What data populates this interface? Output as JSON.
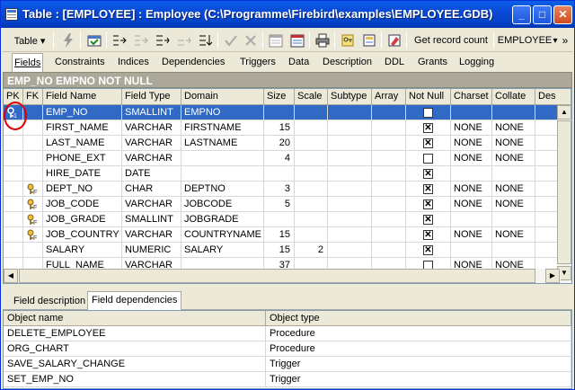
{
  "window": {
    "title": "Table : [EMPLOYEE] : Employee (C:\\Programme\\Firebird\\examples\\EMPLOYEE.GDB)",
    "minimize": "_",
    "maximize": "□",
    "close": "✕"
  },
  "toolbar": {
    "table_dropdown": "Table ▾",
    "get_record_count": "Get record count",
    "employee_dropdown": "EMPLOYEE",
    "employee_arrow": "▾",
    "icons": [
      "lightning-icon",
      "open-table-icon",
      "insert-field-icon",
      "delete-field-icon",
      "move-right-icon",
      "move-disabled-icon",
      "move-down-icon",
      "checkmark-icon",
      "cancel-icon",
      "calendar-icon",
      "calendar-red-icon",
      "print-icon",
      "key-icon",
      "export-icon",
      "eraser-icon"
    ],
    "more": "»"
  },
  "tabs": [
    {
      "label": "Fields",
      "active": true
    },
    {
      "label": "Constraints"
    },
    {
      "label": "Indices"
    },
    {
      "label": "Dependencies"
    },
    {
      "label": "Triggers"
    },
    {
      "label": "Data"
    },
    {
      "label": "Description"
    },
    {
      "label": "DDL"
    },
    {
      "label": "Grants"
    },
    {
      "label": "Logging"
    }
  ],
  "field_header": "EMP_NO EMPNO NOT NULL",
  "grid": {
    "columns": [
      "PK",
      "FK",
      "Field Name",
      "Field Type",
      "Domain",
      "Size",
      "Scale",
      "Subtype",
      "Array",
      "Not Null",
      "Charset",
      "Collate",
      "Des"
    ],
    "rows": [
      {
        "pk": true,
        "fk": false,
        "name": "EMP_NO",
        "type": "SMALLINT",
        "domain": "EMPNO",
        "size": "",
        "scale": "",
        "subtype": "",
        "array": "",
        "not_null": true,
        "charset": "",
        "collate": "",
        "selected": true
      },
      {
        "pk": false,
        "fk": false,
        "name": "FIRST_NAME",
        "type": "VARCHAR",
        "domain": "FIRSTNAME",
        "size": "15",
        "scale": "",
        "subtype": "",
        "array": "",
        "not_null": true,
        "charset": "NONE",
        "collate": "NONE"
      },
      {
        "pk": false,
        "fk": false,
        "name": "LAST_NAME",
        "type": "VARCHAR",
        "domain": "LASTNAME",
        "size": "20",
        "scale": "",
        "subtype": "",
        "array": "",
        "not_null": true,
        "charset": "NONE",
        "collate": "NONE"
      },
      {
        "pk": false,
        "fk": false,
        "name": "PHONE_EXT",
        "type": "VARCHAR",
        "domain": "",
        "size": "4",
        "scale": "",
        "subtype": "",
        "array": "",
        "not_null": false,
        "charset": "NONE",
        "collate": "NONE"
      },
      {
        "pk": false,
        "fk": false,
        "name": "HIRE_DATE",
        "type": "DATE",
        "domain": "",
        "size": "",
        "scale": "",
        "subtype": "",
        "array": "",
        "not_null": true,
        "charset": "",
        "collate": ""
      },
      {
        "pk": false,
        "fk": true,
        "name": "DEPT_NO",
        "type": "CHAR",
        "domain": "DEPTNO",
        "size": "3",
        "scale": "",
        "subtype": "",
        "array": "",
        "not_null": true,
        "charset": "NONE",
        "collate": "NONE"
      },
      {
        "pk": false,
        "fk": true,
        "name": "JOB_CODE",
        "type": "VARCHAR",
        "domain": "JOBCODE",
        "size": "5",
        "scale": "",
        "subtype": "",
        "array": "",
        "not_null": true,
        "charset": "NONE",
        "collate": "NONE"
      },
      {
        "pk": false,
        "fk": true,
        "name": "JOB_GRADE",
        "type": "SMALLINT",
        "domain": "JOBGRADE",
        "size": "",
        "scale": "",
        "subtype": "",
        "array": "",
        "not_null": true,
        "charset": "",
        "collate": ""
      },
      {
        "pk": false,
        "fk": true,
        "name": "JOB_COUNTRY",
        "type": "VARCHAR",
        "domain": "COUNTRYNAME",
        "size": "15",
        "scale": "",
        "subtype": "",
        "array": "",
        "not_null": true,
        "charset": "NONE",
        "collate": "NONE"
      },
      {
        "pk": false,
        "fk": false,
        "name": "SALARY",
        "type": "NUMERIC",
        "domain": "SALARY",
        "size": "15",
        "scale": "2",
        "subtype": "",
        "array": "",
        "not_null": true,
        "charset": "",
        "collate": ""
      },
      {
        "pk": false,
        "fk": false,
        "name": "FULL_NAME",
        "type": "VARCHAR",
        "domain": "",
        "size": "37",
        "scale": "",
        "subtype": "",
        "array": "",
        "not_null": false,
        "charset": "NONE",
        "collate": "NONE"
      }
    ]
  },
  "lower_tabs": [
    {
      "label": "Field description"
    },
    {
      "label": "Field dependencies",
      "active": true
    }
  ],
  "dependencies": {
    "columns": [
      "Object name",
      "Object type"
    ],
    "rows": [
      {
        "name": "DELETE_EMPLOYEE",
        "type": "Procedure"
      },
      {
        "name": "ORG_CHART",
        "type": "Procedure"
      },
      {
        "name": "SAVE_SALARY_CHANGE",
        "type": "Trigger"
      },
      {
        "name": "SET_EMP_NO",
        "type": "Trigger"
      }
    ]
  },
  "colors": {
    "title_blue": "#0a4ad8",
    "selection": "#316ac5",
    "annotation_red": "#e00000"
  }
}
